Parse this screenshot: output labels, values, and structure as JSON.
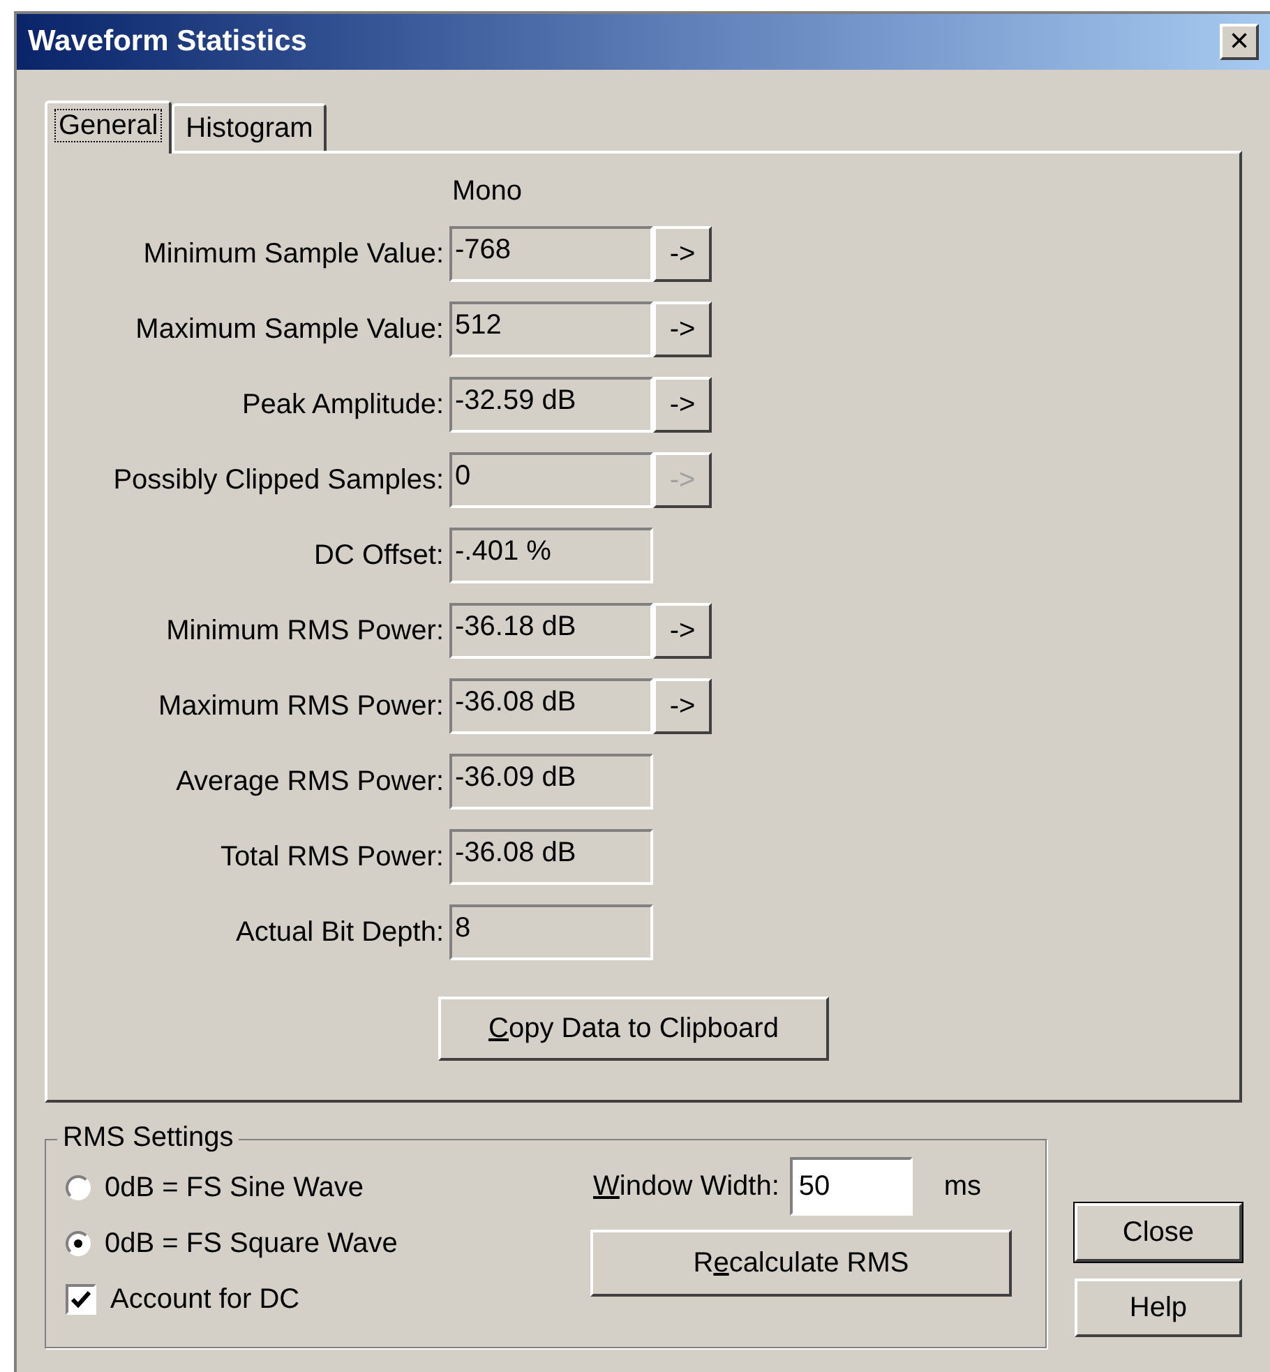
{
  "window": {
    "title": "Waveform Statistics",
    "close": "×"
  },
  "tabs": [
    {
      "label": "General",
      "selected": true
    },
    {
      "label": "Histogram",
      "selected": false
    }
  ],
  "channel_heading": "Mono",
  "stats": [
    {
      "label": "Minimum Sample Value:",
      "value": "-768",
      "jump": {
        "label": "->",
        "disabled": false
      }
    },
    {
      "label": "Maximum Sample Value:",
      "value": "512",
      "jump": {
        "label": "->",
        "disabled": false
      }
    },
    {
      "label": "Peak Amplitude:",
      "value": "-32.59 dB",
      "jump": {
        "label": "->",
        "disabled": false
      }
    },
    {
      "label": "Possibly Clipped Samples:",
      "value": "0",
      "jump": {
        "label": "->",
        "disabled": true
      }
    },
    {
      "label": "DC Offset:",
      "value": "-.401 %"
    },
    {
      "label": "Minimum RMS Power:",
      "value": "-36.18 dB",
      "jump": {
        "label": "->",
        "disabled": false
      }
    },
    {
      "label": "Maximum RMS Power:",
      "value": "-36.08 dB",
      "jump": {
        "label": "->",
        "disabled": false
      }
    },
    {
      "label": "Average RMS Power:",
      "value": "-36.09 dB"
    },
    {
      "label": "Total RMS Power:",
      "value": "-36.08 dB"
    },
    {
      "label": "Actual Bit Depth:",
      "value": "8"
    }
  ],
  "copy_button": {
    "key": "C",
    "after": "opy Data to Clipboard"
  },
  "rms_settings": {
    "title": "RMS Settings",
    "options": [
      {
        "label": "0dB = FS Sine Wave",
        "selected": false
      },
      {
        "label": "0dB = FS Square Wave",
        "selected": true
      }
    ],
    "account_for_dc": {
      "label": "Account for DC",
      "checked": true
    },
    "window_width": {
      "label": {
        "key": "W",
        "after": "indow Width:"
      },
      "value": "50",
      "unit": "ms"
    },
    "recalculate_button": {
      "before": "R",
      "key": "e",
      "after": "calculate RMS"
    }
  },
  "buttons": [
    {
      "label": "Close",
      "default": true
    },
    {
      "label": "Help",
      "default": false
    }
  ]
}
